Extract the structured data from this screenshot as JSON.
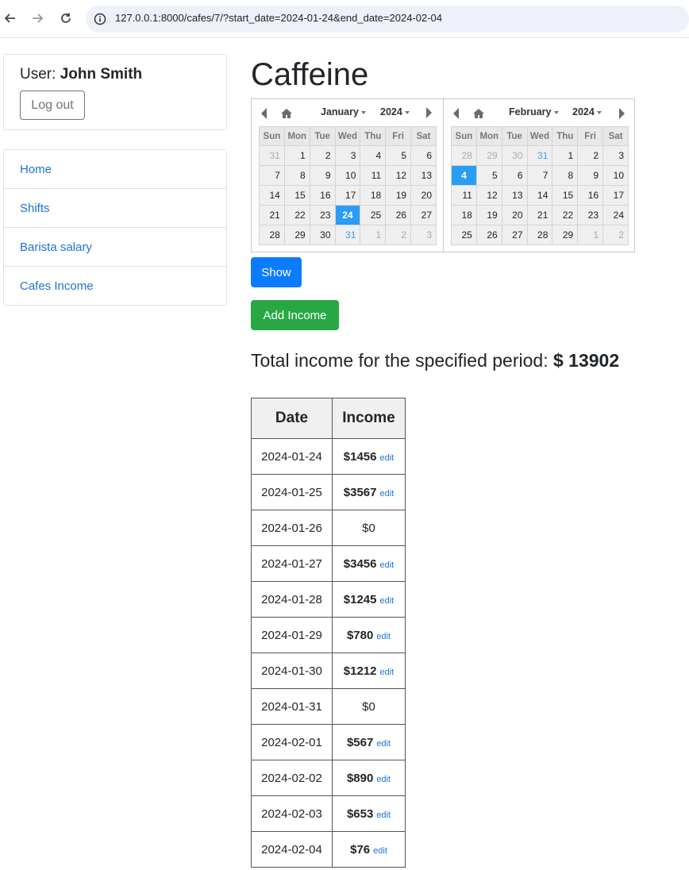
{
  "browser": {
    "url": "127.0.0.1:8000/cafes/7/?start_date=2024-01-24&end_date=2024-02-04"
  },
  "sidebar": {
    "user_prefix": "User:",
    "user_name": "John Smith",
    "logout_label": "Log out",
    "nav": [
      {
        "label": "Home"
      },
      {
        "label": "Shifts"
      },
      {
        "label": "Barista salary"
      },
      {
        "label": "Cafes Income"
      }
    ]
  },
  "main": {
    "title": "Caffeine",
    "show_label": "Show",
    "add_income_label": "Add Income",
    "total_prefix": "Total income for the specified period:",
    "total_value": "$ 13902"
  },
  "calendar": {
    "weekdays": [
      "Sun",
      "Mon",
      "Tue",
      "Wed",
      "Thu",
      "Fri",
      "Sat"
    ],
    "months": [
      {
        "month": "January",
        "year": "2024",
        "weeks": [
          [
            {
              "d": "31",
              "s": "other"
            },
            {
              "d": "1"
            },
            {
              "d": "2"
            },
            {
              "d": "3"
            },
            {
              "d": "4"
            },
            {
              "d": "5"
            },
            {
              "d": "6"
            }
          ],
          [
            {
              "d": "7"
            },
            {
              "d": "8"
            },
            {
              "d": "9"
            },
            {
              "d": "10"
            },
            {
              "d": "11"
            },
            {
              "d": "12"
            },
            {
              "d": "13"
            }
          ],
          [
            {
              "d": "14"
            },
            {
              "d": "15"
            },
            {
              "d": "16"
            },
            {
              "d": "17"
            },
            {
              "d": "18"
            },
            {
              "d": "19"
            },
            {
              "d": "20"
            }
          ],
          [
            {
              "d": "21"
            },
            {
              "d": "22"
            },
            {
              "d": "23"
            },
            {
              "d": "24",
              "s": "selected"
            },
            {
              "d": "25"
            },
            {
              "d": "26"
            },
            {
              "d": "27"
            }
          ],
          [
            {
              "d": "28"
            },
            {
              "d": "29"
            },
            {
              "d": "30"
            },
            {
              "d": "31",
              "s": "inrange"
            },
            {
              "d": "1",
              "s": "other"
            },
            {
              "d": "2",
              "s": "other"
            },
            {
              "d": "3",
              "s": "other"
            }
          ]
        ]
      },
      {
        "month": "February",
        "year": "2024",
        "weeks": [
          [
            {
              "d": "28",
              "s": "other"
            },
            {
              "d": "29",
              "s": "other"
            },
            {
              "d": "30",
              "s": "other"
            },
            {
              "d": "31",
              "s": "inrange"
            },
            {
              "d": "1"
            },
            {
              "d": "2"
            },
            {
              "d": "3"
            }
          ],
          [
            {
              "d": "4",
              "s": "selected"
            },
            {
              "d": "5"
            },
            {
              "d": "6"
            },
            {
              "d": "7"
            },
            {
              "d": "8"
            },
            {
              "d": "9"
            },
            {
              "d": "10"
            }
          ],
          [
            {
              "d": "11"
            },
            {
              "d": "12"
            },
            {
              "d": "13"
            },
            {
              "d": "14"
            },
            {
              "d": "15"
            },
            {
              "d": "16"
            },
            {
              "d": "17"
            }
          ],
          [
            {
              "d": "18"
            },
            {
              "d": "19"
            },
            {
              "d": "20"
            },
            {
              "d": "21"
            },
            {
              "d": "22"
            },
            {
              "d": "23"
            },
            {
              "d": "24"
            }
          ],
          [
            {
              "d": "25"
            },
            {
              "d": "26"
            },
            {
              "d": "27"
            },
            {
              "d": "28"
            },
            {
              "d": "29"
            },
            {
              "d": "1",
              "s": "other"
            },
            {
              "d": "2",
              "s": "other"
            }
          ]
        ]
      }
    ]
  },
  "table": {
    "headers": [
      "Date",
      "Income"
    ],
    "edit_label": "edit",
    "rows": [
      {
        "date": "2024-01-24",
        "income": "$1456",
        "editable": true
      },
      {
        "date": "2024-01-25",
        "income": "$3567",
        "editable": true
      },
      {
        "date": "2024-01-26",
        "income": "$0",
        "editable": false
      },
      {
        "date": "2024-01-27",
        "income": "$3456",
        "editable": true
      },
      {
        "date": "2024-01-28",
        "income": "$1245",
        "editable": true
      },
      {
        "date": "2024-01-29",
        "income": "$780",
        "editable": true
      },
      {
        "date": "2024-01-30",
        "income": "$1212",
        "editable": true
      },
      {
        "date": "2024-01-31",
        "income": "$0",
        "editable": false
      },
      {
        "date": "2024-02-01",
        "income": "$567",
        "editable": true
      },
      {
        "date": "2024-02-02",
        "income": "$890",
        "editable": true
      },
      {
        "date": "2024-02-03",
        "income": "$653",
        "editable": true
      },
      {
        "date": "2024-02-04",
        "income": "$76",
        "editable": true
      }
    ]
  },
  "colors": {
    "link": "#1a73d6",
    "primary": "#0d7bff",
    "success": "#28a745",
    "selected_day": "#2a9df4"
  }
}
